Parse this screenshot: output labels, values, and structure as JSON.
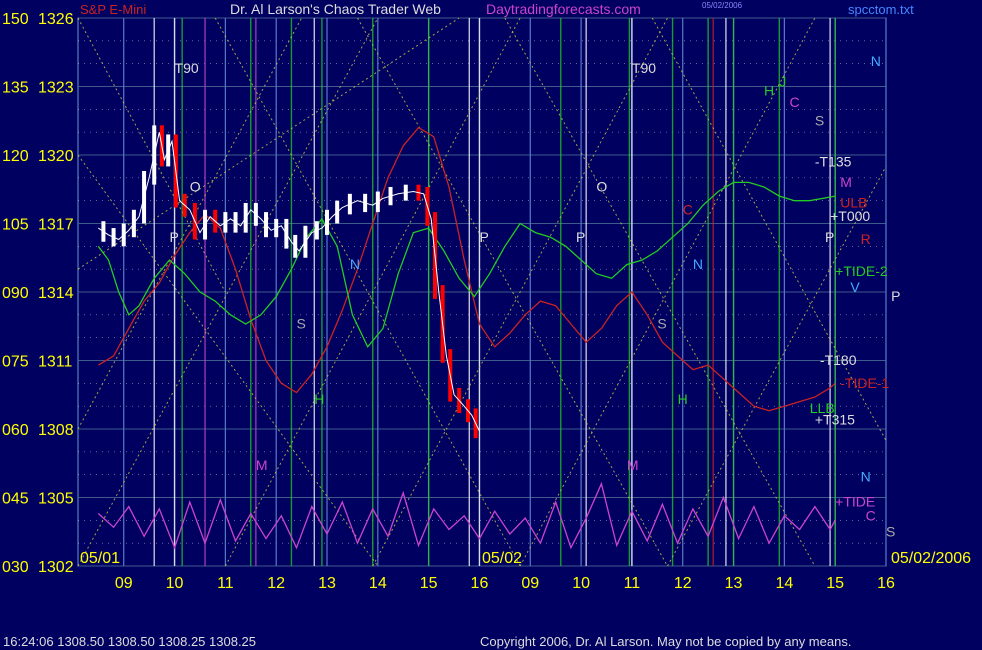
{
  "header": {
    "left_title": "S&P E-Mini",
    "center_title": "Dr. Al Larson's Chaos Trader Web",
    "site": "Daytradingforecasts.com",
    "file_name": "spcctom.txt",
    "date_stamp_top": "05/02/2006"
  },
  "footer": {
    "time_quote": "16:24:06  1308.50 1308.50 1308.25 1308.25",
    "copyright": "Copyright 2006, Dr. Al Larson. May not be copied by any means."
  },
  "colors": {
    "background": "#000060",
    "grid": "#3c5a8a",
    "axis_text": "#ffff00",
    "price_bar_up": "#ffffff",
    "price_bar_down": "#ff0000",
    "tide": "#cc44cc",
    "tide1": "#cc2222",
    "tide2": "#22cc22",
    "diag": "#cccc44"
  },
  "chart_data": {
    "type": "line",
    "ylim": [
      1302,
      1326
    ],
    "y_ticks": [
      {
        "left": "150",
        "price": 1326
      },
      {
        "left": "135",
        "price": 1323
      },
      {
        "left": "120",
        "price": 1320
      },
      {
        "left": "105",
        "price": 1317
      },
      {
        "left": "090",
        "price": 1314
      },
      {
        "left": "075",
        "price": 1311
      },
      {
        "left": "060",
        "price": 1308
      },
      {
        "left": "045",
        "price": 1305
      },
      {
        "left": "030",
        "price": 1302
      }
    ],
    "x_ticks": [
      "09",
      "10",
      "11",
      "12",
      "13",
      "14",
      "15",
      "16",
      "09",
      "10",
      "11",
      "12",
      "13",
      "14",
      "15",
      "16"
    ],
    "date_labels": [
      "05/01",
      "05/02",
      "05/02/2006"
    ],
    "price_path": [
      [
        8.5,
        1316.8
      ],
      [
        8.7,
        1316.5
      ],
      [
        8.9,
        1316.3
      ],
      [
        9.1,
        1316.7
      ],
      [
        9.3,
        1317.3
      ],
      [
        9.5,
        1319.0
      ],
      [
        9.7,
        1321.0
      ],
      [
        9.8,
        1319.8
      ],
      [
        9.95,
        1320.6
      ],
      [
        10.1,
        1318.0
      ],
      [
        10.3,
        1317.6
      ],
      [
        10.5,
        1316.6
      ],
      [
        10.7,
        1317.3
      ],
      [
        10.9,
        1316.9
      ],
      [
        11.1,
        1317.2
      ],
      [
        11.3,
        1316.9
      ],
      [
        11.5,
        1317.6
      ],
      [
        11.7,
        1317.2
      ],
      [
        11.9,
        1316.7
      ],
      [
        12.1,
        1316.9
      ],
      [
        12.3,
        1316.2
      ],
      [
        12.45,
        1315.8
      ],
      [
        12.7,
        1316.6
      ],
      [
        12.9,
        1316.8
      ],
      [
        13.1,
        1317.3
      ],
      [
        13.3,
        1317.7
      ],
      [
        13.6,
        1318.0
      ],
      [
        13.9,
        1317.8
      ],
      [
        14.1,
        1318.1
      ],
      [
        14.4,
        1318.3
      ],
      [
        14.7,
        1318.4
      ],
      [
        14.9,
        1318.3
      ],
      [
        15.05,
        1317.2
      ],
      [
        15.2,
        1314.0
      ],
      [
        15.35,
        1311.2
      ],
      [
        15.5,
        1309.5
      ],
      [
        15.7,
        1309.0
      ],
      [
        15.85,
        1308.6
      ],
      [
        16.0,
        1307.9
      ]
    ],
    "tide_path": [
      [
        8.5,
        1304.3
      ],
      [
        8.8,
        1303.7
      ],
      [
        9.1,
        1304.6
      ],
      [
        9.4,
        1303.3
      ],
      [
        9.7,
        1304.5
      ],
      [
        10.0,
        1302.8
      ],
      [
        10.3,
        1304.8
      ],
      [
        10.6,
        1303.0
      ],
      [
        10.9,
        1304.9
      ],
      [
        11.2,
        1303.1
      ],
      [
        11.5,
        1304.3
      ],
      [
        11.8,
        1303.2
      ],
      [
        12.1,
        1304.2
      ],
      [
        12.4,
        1302.8
      ],
      [
        12.7,
        1304.6
      ],
      [
        13.0,
        1303.4
      ],
      [
        13.3,
        1304.8
      ],
      [
        13.6,
        1303.0
      ],
      [
        13.9,
        1304.5
      ],
      [
        14.2,
        1303.3
      ],
      [
        14.5,
        1305.2
      ],
      [
        14.8,
        1302.9
      ],
      [
        15.1,
        1304.5
      ],
      [
        15.4,
        1303.6
      ],
      [
        15.7,
        1304.2
      ],
      [
        16.0,
        1303.2
      ],
      [
        16.3,
        1304.4
      ],
      [
        16.6,
        1303.4
      ],
      [
        16.9,
        1304.1
      ],
      [
        17.2,
        1303.0
      ],
      [
        17.5,
        1304.8
      ],
      [
        17.8,
        1302.8
      ],
      [
        18.1,
        1304.1
      ],
      [
        18.4,
        1305.6
      ],
      [
        18.7,
        1302.9
      ],
      [
        19.0,
        1304.4
      ],
      [
        19.3,
        1303.1
      ],
      [
        19.6,
        1304.7
      ],
      [
        19.9,
        1303.0
      ],
      [
        20.2,
        1304.5
      ],
      [
        20.5,
        1303.3
      ],
      [
        20.8,
        1305.0
      ],
      [
        21.1,
        1303.2
      ],
      [
        21.4,
        1304.6
      ],
      [
        21.7,
        1303.0
      ],
      [
        22.0,
        1304.2
      ],
      [
        22.3,
        1303.6
      ],
      [
        22.6,
        1304.6
      ],
      [
        22.9,
        1303.6
      ],
      [
        23.0,
        1304.0
      ]
    ],
    "tide1_path": [
      [
        8.5,
        1310.8
      ],
      [
        8.8,
        1311.2
      ],
      [
        9.1,
        1312.4
      ],
      [
        9.4,
        1313.6
      ],
      [
        9.7,
        1314.4
      ],
      [
        10.0,
        1315.6
      ],
      [
        10.3,
        1316.6
      ],
      [
        10.6,
        1317.4
      ],
      [
        10.9,
        1316.8
      ],
      [
        11.2,
        1315.0
      ],
      [
        11.5,
        1312.8
      ],
      [
        11.8,
        1311.0
      ],
      [
        12.1,
        1310.0
      ],
      [
        12.4,
        1309.6
      ],
      [
        12.7,
        1310.4
      ],
      [
        13.0,
        1311.6
      ],
      [
        13.3,
        1313.2
      ],
      [
        13.6,
        1315.0
      ],
      [
        13.9,
        1317.0
      ],
      [
        14.2,
        1319.0
      ],
      [
        14.5,
        1320.4
      ],
      [
        14.8,
        1321.2
      ],
      [
        15.1,
        1320.8
      ],
      [
        15.4,
        1318.6
      ],
      [
        15.7,
        1315.4
      ],
      [
        16.0,
        1312.6
      ],
      [
        16.3,
        1311.6
      ],
      [
        16.6,
        1312.2
      ],
      [
        16.9,
        1313.0
      ],
      [
        17.2,
        1313.6
      ],
      [
        17.5,
        1313.4
      ],
      [
        17.8,
        1312.6
      ],
      [
        18.1,
        1311.8
      ],
      [
        18.4,
        1312.4
      ],
      [
        18.7,
        1313.4
      ],
      [
        19.0,
        1314.0
      ],
      [
        19.3,
        1313.0
      ],
      [
        19.6,
        1311.8
      ],
      [
        19.9,
        1311.2
      ],
      [
        20.2,
        1310.6
      ],
      [
        20.5,
        1310.8
      ],
      [
        20.8,
        1310.2
      ],
      [
        21.1,
        1309.6
      ],
      [
        21.4,
        1309.0
      ],
      [
        21.7,
        1308.8
      ],
      [
        22.0,
        1309.0
      ],
      [
        22.3,
        1309.2
      ],
      [
        22.6,
        1309.4
      ],
      [
        22.9,
        1309.8
      ],
      [
        23.0,
        1310.0
      ]
    ],
    "tide2_path": [
      [
        8.5,
        1316.0
      ],
      [
        8.7,
        1315.4
      ],
      [
        8.9,
        1314.0
      ],
      [
        9.1,
        1313.0
      ],
      [
        9.3,
        1313.4
      ],
      [
        9.6,
        1314.6
      ],
      [
        9.9,
        1315.4
      ],
      [
        10.2,
        1314.8
      ],
      [
        10.5,
        1314.0
      ],
      [
        10.8,
        1313.6
      ],
      [
        11.1,
        1313.0
      ],
      [
        11.4,
        1312.6
      ],
      [
        11.7,
        1313.0
      ],
      [
        12.0,
        1313.8
      ],
      [
        12.3,
        1315.0
      ],
      [
        12.6,
        1316.4
      ],
      [
        12.9,
        1317.2
      ],
      [
        13.2,
        1316.0
      ],
      [
        13.5,
        1313.0
      ],
      [
        13.8,
        1311.6
      ],
      [
        14.1,
        1312.4
      ],
      [
        14.4,
        1314.8
      ],
      [
        14.7,
        1316.6
      ],
      [
        15.0,
        1316.8
      ],
      [
        15.3,
        1315.8
      ],
      [
        15.6,
        1314.6
      ],
      [
        15.9,
        1313.8
      ],
      [
        16.2,
        1314.8
      ],
      [
        16.5,
        1316.0
      ],
      [
        16.8,
        1317.0
      ],
      [
        17.1,
        1316.6
      ],
      [
        17.4,
        1316.4
      ],
      [
        17.7,
        1316.0
      ],
      [
        18.0,
        1315.4
      ],
      [
        18.3,
        1314.8
      ],
      [
        18.6,
        1314.6
      ],
      [
        18.9,
        1315.2
      ],
      [
        19.2,
        1315.4
      ],
      [
        19.5,
        1315.8
      ],
      [
        19.8,
        1316.4
      ],
      [
        20.1,
        1317.0
      ],
      [
        20.4,
        1317.8
      ],
      [
        20.7,
        1318.4
      ],
      [
        21.0,
        1318.8
      ],
      [
        21.3,
        1318.8
      ],
      [
        21.6,
        1318.6
      ],
      [
        21.9,
        1318.2
      ],
      [
        22.2,
        1318.0
      ],
      [
        22.5,
        1318.0
      ],
      [
        23.0,
        1318.2
      ]
    ],
    "right_labels": [
      {
        "text": "N",
        "color": "#44aaff",
        "x": 23.7,
        "y": 1323.9
      },
      {
        "text": "J",
        "color": "#22cc22",
        "x": 21.9,
        "y": 1323.0
      },
      {
        "text": "H",
        "color": "#22cc22",
        "x": 21.6,
        "y": 1322.6
      },
      {
        "text": "C",
        "color": "#cc44cc",
        "x": 22.1,
        "y": 1322.1
      },
      {
        "text": "S",
        "color": "#aaaaaa",
        "x": 22.6,
        "y": 1321.3
      },
      {
        "text": "-T135",
        "color": "#dddddd",
        "x": 22.6,
        "y": 1319.5
      },
      {
        "text": "M",
        "color": "#cc44cc",
        "x": 23.1,
        "y": 1318.6
      },
      {
        "text": "ULB",
        "color": "#cc2222",
        "x": 23.1,
        "y": 1317.7
      },
      {
        "text": "+T000",
        "color": "#dddddd",
        "x": 22.9,
        "y": 1317.1
      },
      {
        "text": "R",
        "color": "#cc2222",
        "x": 23.5,
        "y": 1316.1
      },
      {
        "text": "+TIDE-2",
        "color": "#22cc22",
        "x": 23.0,
        "y": 1314.7
      },
      {
        "text": "P",
        "color": "#dddddd",
        "x": 24.1,
        "y": 1313.6
      },
      {
        "text": "-T180",
        "color": "#dddddd",
        "x": 22.7,
        "y": 1310.8
      },
      {
        "text": "-TIDE-1",
        "color": "#cc2222",
        "x": 23.1,
        "y": 1309.8
      },
      {
        "text": "LLB",
        "color": "#22cc22",
        "x": 22.5,
        "y": 1308.7
      },
      {
        "text": "+T315",
        "color": "#dddddd",
        "x": 22.6,
        "y": 1308.2
      },
      {
        "text": "N",
        "color": "#44aaff",
        "x": 23.5,
        "y": 1305.7
      },
      {
        "text": "+TIDE",
        "color": "#cc44cc",
        "x": 23.0,
        "y": 1304.6
      },
      {
        "text": "C",
        "color": "#cc44cc",
        "x": 23.6,
        "y": 1304.0
      },
      {
        "text": "S",
        "color": "#aaaaaa",
        "x": 24.0,
        "y": 1303.3
      }
    ],
    "chart_labels": [
      {
        "text": "T90",
        "color": "#dddddd",
        "x": 10.0,
        "y": 1323.6
      },
      {
        "text": "T90",
        "color": "#dddddd",
        "x": 19.0,
        "y": 1323.6
      },
      {
        "text": "P",
        "color": "#dddddd",
        "x": 9.9,
        "y": 1316.2
      },
      {
        "text": "O",
        "color": "#dddddd",
        "x": 10.3,
        "y": 1318.4
      },
      {
        "text": "P",
        "color": "#dddddd",
        "x": 16.0,
        "y": 1316.2
      },
      {
        "text": "P",
        "color": "#dddddd",
        "x": 17.9,
        "y": 1316.2
      },
      {
        "text": "O",
        "color": "#dddddd",
        "x": 18.3,
        "y": 1318.4
      },
      {
        "text": "P",
        "color": "#dddddd",
        "x": 22.8,
        "y": 1316.2
      },
      {
        "text": "N",
        "color": "#44aaff",
        "x": 13.45,
        "y": 1315.0
      },
      {
        "text": "N",
        "color": "#44aaff",
        "x": 20.2,
        "y": 1315.0
      },
      {
        "text": "S",
        "color": "#aaaaaa",
        "x": 12.4,
        "y": 1312.4
      },
      {
        "text": "S",
        "color": "#aaaaaa",
        "x": 19.5,
        "y": 1312.4
      },
      {
        "text": "H",
        "color": "#22cc22",
        "x": 12.75,
        "y": 1309.1
      },
      {
        "text": "H",
        "color": "#22cc22",
        "x": 19.9,
        "y": 1309.1
      },
      {
        "text": "M",
        "color": "#cc44cc",
        "x": 11.6,
        "y": 1306.2
      },
      {
        "text": "M",
        "color": "#cc44cc",
        "x": 18.9,
        "y": 1306.2
      },
      {
        "text": "V",
        "color": "#44aaff",
        "x": 23.3,
        "y": 1314.0
      },
      {
        "text": "C",
        "color": "#cc2222",
        "x": 20.0,
        "y": 1317.4
      }
    ]
  }
}
